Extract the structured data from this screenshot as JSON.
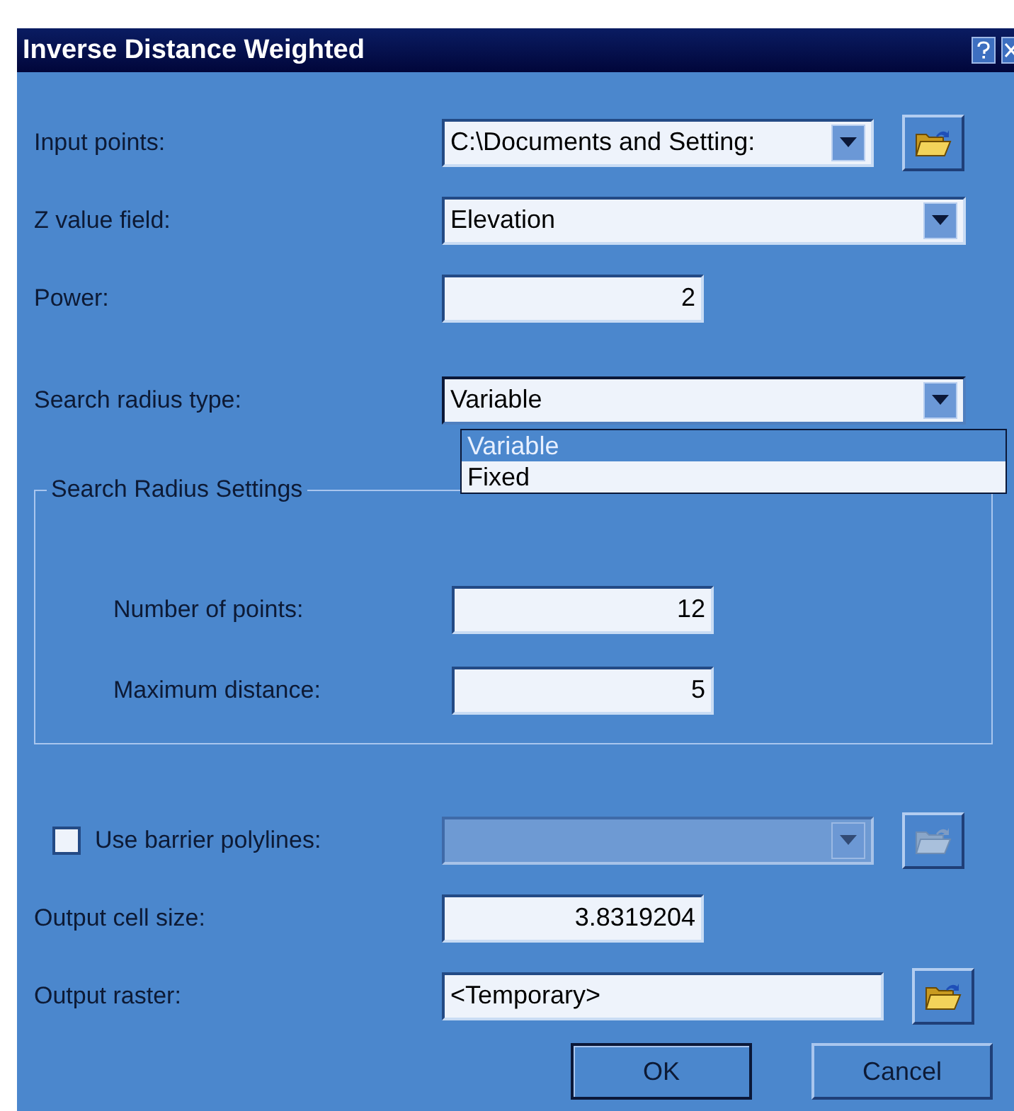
{
  "window": {
    "title": "Inverse Distance Weighted"
  },
  "rows_top": [
    {
      "kind": "combo",
      "label": "Input points:",
      "value": "C:\\Documents and Setting:",
      "browse": true
    },
    {
      "kind": "combo",
      "label": "Z value field:",
      "value": "Elevation",
      "browse": false
    },
    {
      "kind": "number",
      "label": "Power:",
      "value": "2",
      "browse": false
    },
    {
      "kind": "combo",
      "label": "Search radius type:",
      "value": "Variable",
      "browse": false,
      "expanded": true,
      "options": [
        {
          "label": "Variable",
          "selected": true
        },
        {
          "label": "Fixed",
          "selected": false
        }
      ]
    }
  ],
  "search_radius_settings": {
    "title": "Search Radius Settings",
    "rows": [
      {
        "kind": "number",
        "label": "Number of points:",
        "value": "12"
      },
      {
        "kind": "number",
        "label": "Maximum distance:",
        "value": "5"
      }
    ]
  },
  "rows_bottom": [
    {
      "kind": "checkbox",
      "label": "Use barrier polylines:",
      "checked": false,
      "browse": true
    },
    {
      "kind": "number",
      "label": "Output cell size:",
      "value": "3.8319204",
      "browse": false
    },
    {
      "kind": "text",
      "label": "Output raster:",
      "value": "<Temporary>",
      "browse": true
    }
  ],
  "buttons": [
    {
      "label": "OK",
      "default": true
    },
    {
      "label": "Cancel",
      "default": false
    }
  ]
}
